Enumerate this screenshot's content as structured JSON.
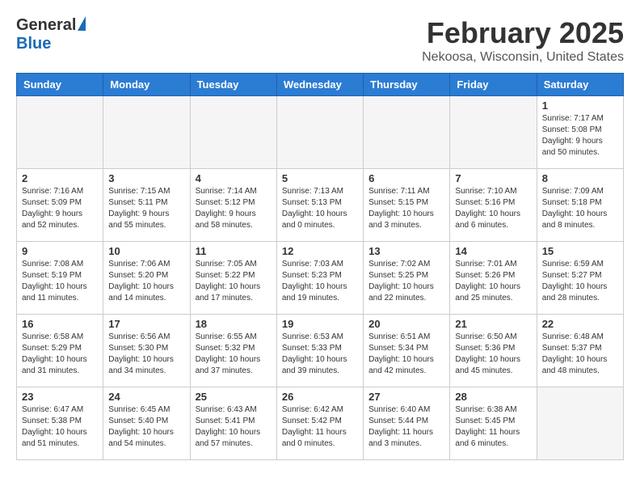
{
  "logo": {
    "general": "General",
    "blue": "Blue"
  },
  "title": "February 2025",
  "location": "Nekoosa, Wisconsin, United States",
  "headers": [
    "Sunday",
    "Monday",
    "Tuesday",
    "Wednesday",
    "Thursday",
    "Friday",
    "Saturday"
  ],
  "weeks": [
    [
      {
        "day": "",
        "info": ""
      },
      {
        "day": "",
        "info": ""
      },
      {
        "day": "",
        "info": ""
      },
      {
        "day": "",
        "info": ""
      },
      {
        "day": "",
        "info": ""
      },
      {
        "day": "",
        "info": ""
      },
      {
        "day": "1",
        "info": "Sunrise: 7:17 AM\nSunset: 5:08 PM\nDaylight: 9 hours and 50 minutes."
      }
    ],
    [
      {
        "day": "2",
        "info": "Sunrise: 7:16 AM\nSunset: 5:09 PM\nDaylight: 9 hours and 52 minutes."
      },
      {
        "day": "3",
        "info": "Sunrise: 7:15 AM\nSunset: 5:11 PM\nDaylight: 9 hours and 55 minutes."
      },
      {
        "day": "4",
        "info": "Sunrise: 7:14 AM\nSunset: 5:12 PM\nDaylight: 9 hours and 58 minutes."
      },
      {
        "day": "5",
        "info": "Sunrise: 7:13 AM\nSunset: 5:13 PM\nDaylight: 10 hours and 0 minutes."
      },
      {
        "day": "6",
        "info": "Sunrise: 7:11 AM\nSunset: 5:15 PM\nDaylight: 10 hours and 3 minutes."
      },
      {
        "day": "7",
        "info": "Sunrise: 7:10 AM\nSunset: 5:16 PM\nDaylight: 10 hours and 6 minutes."
      },
      {
        "day": "8",
        "info": "Sunrise: 7:09 AM\nSunset: 5:18 PM\nDaylight: 10 hours and 8 minutes."
      }
    ],
    [
      {
        "day": "9",
        "info": "Sunrise: 7:08 AM\nSunset: 5:19 PM\nDaylight: 10 hours and 11 minutes."
      },
      {
        "day": "10",
        "info": "Sunrise: 7:06 AM\nSunset: 5:20 PM\nDaylight: 10 hours and 14 minutes."
      },
      {
        "day": "11",
        "info": "Sunrise: 7:05 AM\nSunset: 5:22 PM\nDaylight: 10 hours and 17 minutes."
      },
      {
        "day": "12",
        "info": "Sunrise: 7:03 AM\nSunset: 5:23 PM\nDaylight: 10 hours and 19 minutes."
      },
      {
        "day": "13",
        "info": "Sunrise: 7:02 AM\nSunset: 5:25 PM\nDaylight: 10 hours and 22 minutes."
      },
      {
        "day": "14",
        "info": "Sunrise: 7:01 AM\nSunset: 5:26 PM\nDaylight: 10 hours and 25 minutes."
      },
      {
        "day": "15",
        "info": "Sunrise: 6:59 AM\nSunset: 5:27 PM\nDaylight: 10 hours and 28 minutes."
      }
    ],
    [
      {
        "day": "16",
        "info": "Sunrise: 6:58 AM\nSunset: 5:29 PM\nDaylight: 10 hours and 31 minutes."
      },
      {
        "day": "17",
        "info": "Sunrise: 6:56 AM\nSunset: 5:30 PM\nDaylight: 10 hours and 34 minutes."
      },
      {
        "day": "18",
        "info": "Sunrise: 6:55 AM\nSunset: 5:32 PM\nDaylight: 10 hours and 37 minutes."
      },
      {
        "day": "19",
        "info": "Sunrise: 6:53 AM\nSunset: 5:33 PM\nDaylight: 10 hours and 39 minutes."
      },
      {
        "day": "20",
        "info": "Sunrise: 6:51 AM\nSunset: 5:34 PM\nDaylight: 10 hours and 42 minutes."
      },
      {
        "day": "21",
        "info": "Sunrise: 6:50 AM\nSunset: 5:36 PM\nDaylight: 10 hours and 45 minutes."
      },
      {
        "day": "22",
        "info": "Sunrise: 6:48 AM\nSunset: 5:37 PM\nDaylight: 10 hours and 48 minutes."
      }
    ],
    [
      {
        "day": "23",
        "info": "Sunrise: 6:47 AM\nSunset: 5:38 PM\nDaylight: 10 hours and 51 minutes."
      },
      {
        "day": "24",
        "info": "Sunrise: 6:45 AM\nSunset: 5:40 PM\nDaylight: 10 hours and 54 minutes."
      },
      {
        "day": "25",
        "info": "Sunrise: 6:43 AM\nSunset: 5:41 PM\nDaylight: 10 hours and 57 minutes."
      },
      {
        "day": "26",
        "info": "Sunrise: 6:42 AM\nSunset: 5:42 PM\nDaylight: 11 hours and 0 minutes."
      },
      {
        "day": "27",
        "info": "Sunrise: 6:40 AM\nSunset: 5:44 PM\nDaylight: 11 hours and 3 minutes."
      },
      {
        "day": "28",
        "info": "Sunrise: 6:38 AM\nSunset: 5:45 PM\nDaylight: 11 hours and 6 minutes."
      },
      {
        "day": "",
        "info": ""
      }
    ]
  ]
}
